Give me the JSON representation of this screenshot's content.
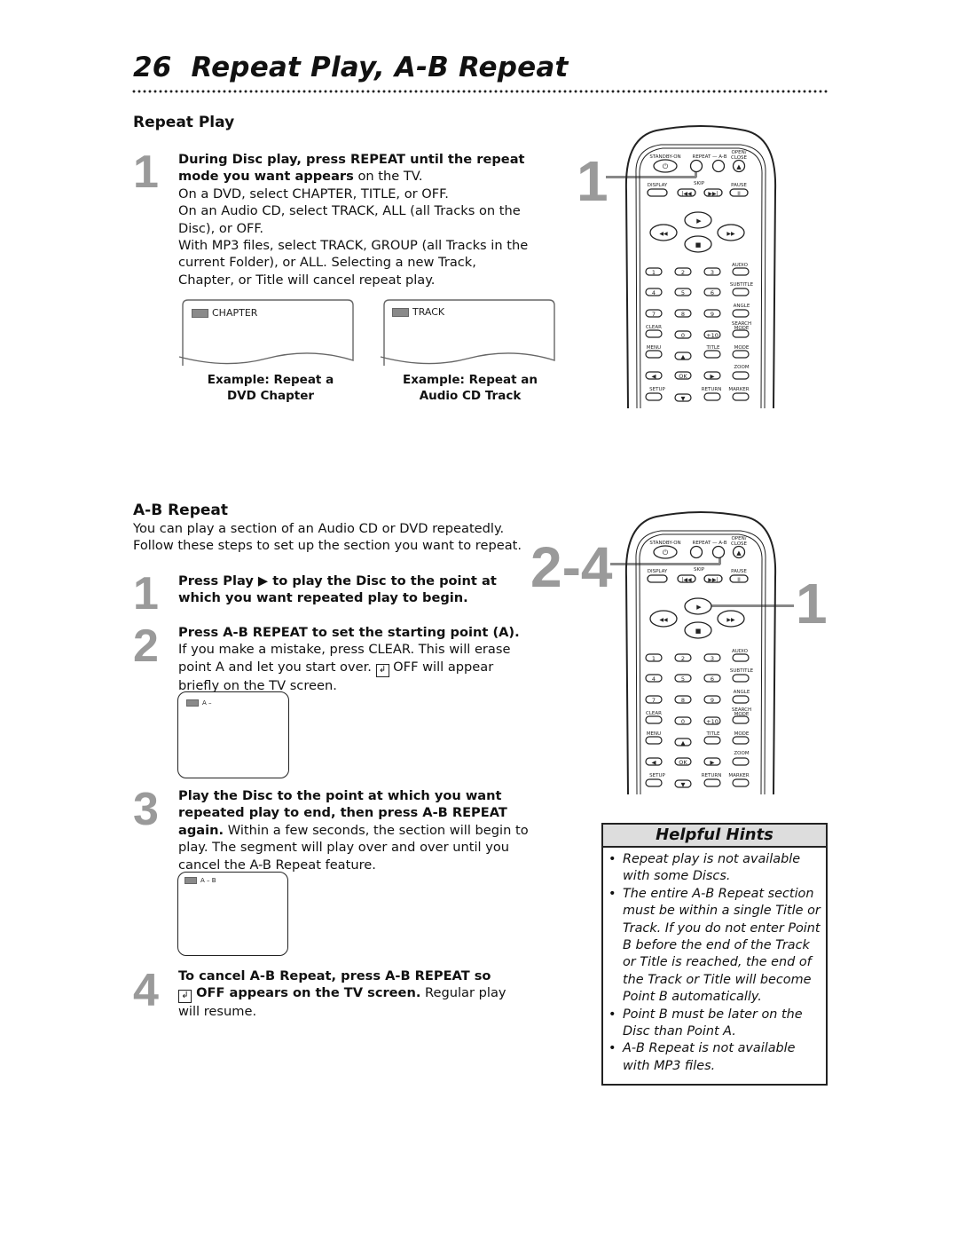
{
  "page": {
    "number": "26",
    "title": "Repeat Play, A-B Repeat"
  },
  "repeat_play": {
    "heading": "Repeat Play",
    "step1": {
      "number": "1",
      "bold": "During Disc play, press REPEAT until the repeat mode you want appears",
      "rest": " on the TV.",
      "lines": [
        "On a DVD, select CHAPTER, TITLE, or OFF.",
        "On an Audio CD, select TRACK, ALL (all Tracks on the Disc), or OFF.",
        "With MP3 files, select TRACK, GROUP (all Tracks in the current Folder), or ALL. Selecting a new Track, Chapter, or Title will cancel repeat play."
      ]
    },
    "examples": [
      {
        "screen_text": "CHAPTER",
        "caption_line1": "Example: Repeat a",
        "caption_line2": "DVD Chapter"
      },
      {
        "screen_text": "TRACK",
        "caption_line1": "Example: Repeat an",
        "caption_line2": "Audio CD Track"
      }
    ],
    "callout": "1"
  },
  "ab_repeat": {
    "heading": "A-B Repeat",
    "intro": "You can play a section of an Audio CD or DVD repeatedly. Follow these steps to set up the section you want to repeat.",
    "steps": [
      {
        "number": "1",
        "bold": "Press Play ▶ to play the Disc to the point at which you want repeated play to begin.",
        "rest": ""
      },
      {
        "number": "2",
        "bold": "Press A-B REPEAT to set the starting point (A).",
        "rest": " If you make a mistake, press CLEAR. This will erase point A and let you start over.",
        "rest2": " OFF will appear briefly on the TV screen.",
        "screen_text": "A –"
      },
      {
        "number": "3",
        "bold": "Play the Disc to the point at which you want repeated play to end, then press A-B REPEAT again.",
        "rest": " Within a few seconds, the section will begin to play. The segment will play over and over until you cancel the A-B Repeat feature.",
        "screen_text": "A – B"
      },
      {
        "number": "4",
        "bold": "To cancel A-B Repeat, press A-B REPEAT so",
        "bold2": " OFF appears on the TV screen.",
        "rest": " Regular play will resume."
      }
    ],
    "callout_left": "2-4",
    "callout_right": "1"
  },
  "repeat_glyph": "↲",
  "remote": {
    "row1_labels": [
      "STANDBY-ON",
      "REPEAT — A-B",
      "OPEN/ CLOSE"
    ],
    "row2_labels": [
      "DISPLAY",
      "SKIP",
      "PAUSE"
    ],
    "transport": {
      "play": "▶",
      "stop": "■",
      "rew": "◂◂",
      "ffw": "▸▸",
      "prev": "|◂◂",
      "next": "▸▸|",
      "pause": "II",
      "eject": "▲",
      "power": "⏻"
    },
    "side_labels": [
      "AUDIO",
      "SUBTITLE",
      "ANGLE",
      "SEARCH MODE",
      "MODE",
      "ZOOM",
      "MARKER"
    ],
    "digits": [
      "1",
      "2",
      "3",
      "4",
      "5",
      "6",
      "7",
      "8",
      "9",
      "0",
      "+10"
    ],
    "other_labels": {
      "clear": "CLEAR",
      "menu": "MENU",
      "title": "TITLE",
      "setup": "SETUP",
      "return": "RETURN",
      "ok": "OK"
    }
  },
  "hints": {
    "title": "Helpful Hints",
    "items": [
      "Repeat play is not available with some Discs.",
      "The entire A-B Repeat section must be within a single Title or Track. If you do not enter Point B before the end of the Track or Title is reached, the end of the Track or Title will become Point B automatically.",
      "Point B must be later on the Disc than Point A.",
      "A-B Repeat is not available with MP3 files."
    ]
  }
}
